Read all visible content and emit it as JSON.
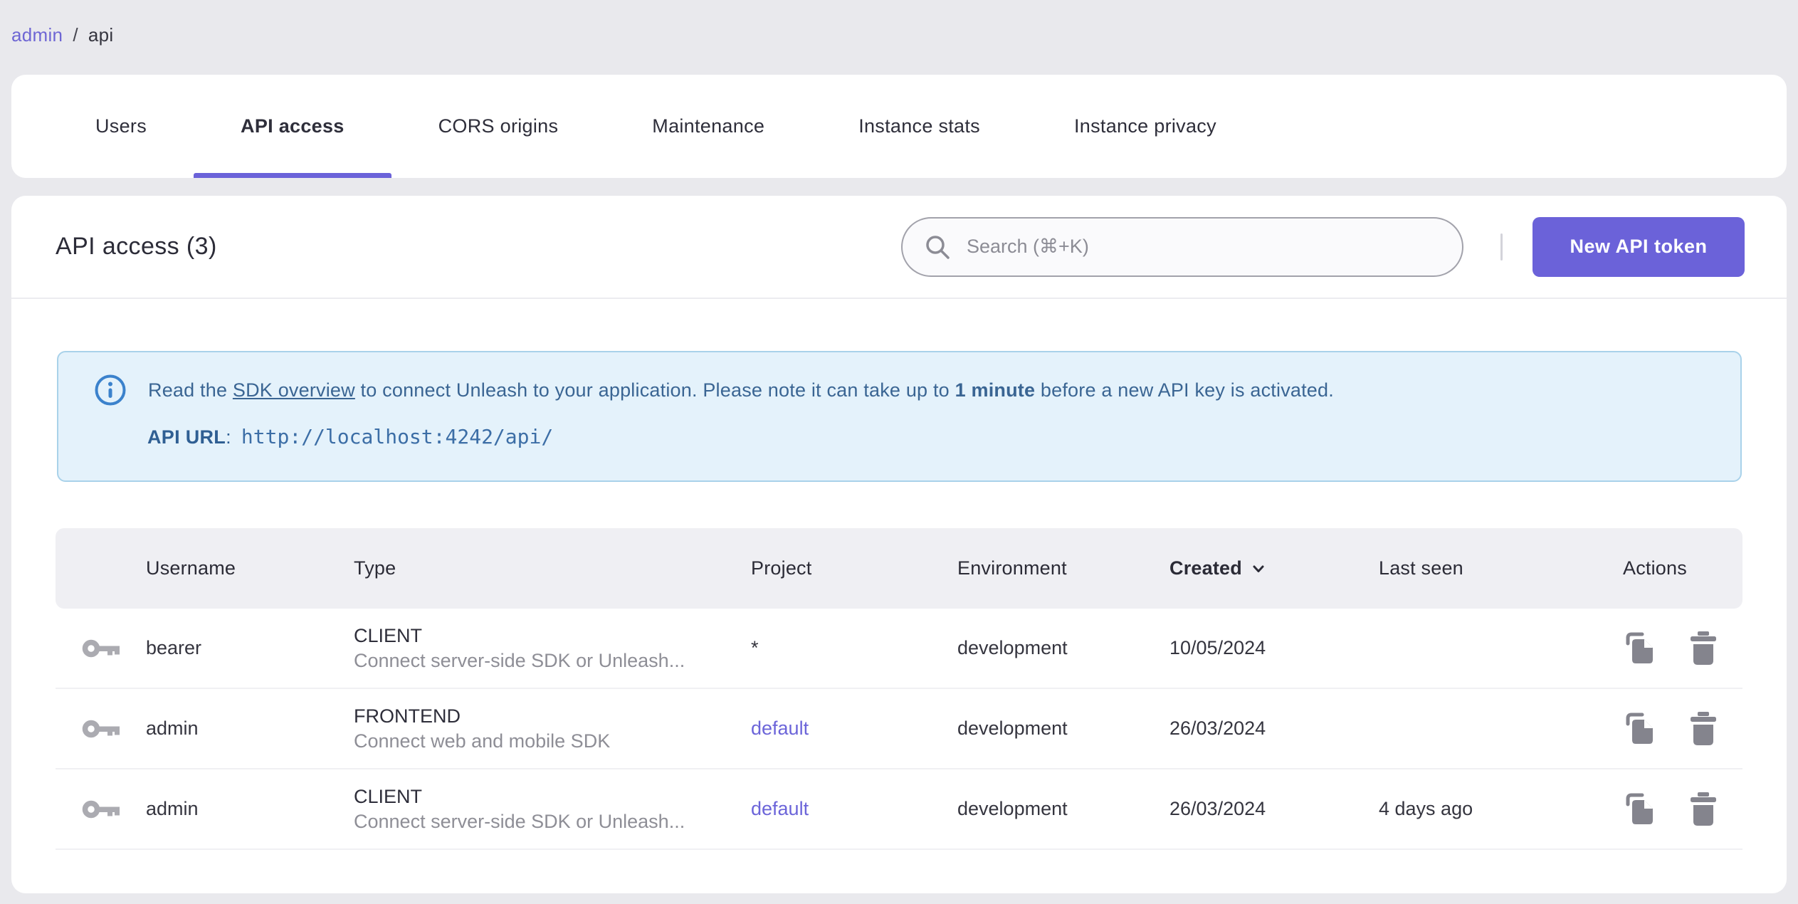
{
  "breadcrumb": {
    "items": [
      {
        "label": "admin"
      },
      {
        "label": "api"
      }
    ],
    "separator": "/"
  },
  "tabs": {
    "items": [
      {
        "label": "Users",
        "active": false
      },
      {
        "label": "API access",
        "active": true
      },
      {
        "label": "CORS origins",
        "active": false
      },
      {
        "label": "Maintenance",
        "active": false
      },
      {
        "label": "Instance stats",
        "active": false
      },
      {
        "label": "Instance privacy",
        "active": false
      }
    ]
  },
  "header": {
    "title": "API access (3)",
    "search_placeholder": "Search (⌘+K)",
    "new_token_button": "New API token"
  },
  "banner": {
    "text_before_link": "Read the ",
    "link_text": "SDK overview",
    "text_middle": " to connect Unleash to your application. Please note it can take up to ",
    "bold_text": "1 minute",
    "text_end": " before a new API key is activated.",
    "api_url_label": "API URL",
    "api_url_colon": ":",
    "api_url": "http://localhost:4242/api/"
  },
  "table": {
    "columns": [
      "Username",
      "Type",
      "Project",
      "Environment",
      "Created",
      "Last seen",
      "Actions"
    ],
    "sorted_column": "Created",
    "sort_direction": "desc",
    "rows": [
      {
        "username": "bearer",
        "type": "CLIENT",
        "type_description": "Connect server-side SDK or Unleash...",
        "project": "*",
        "project_is_link": false,
        "environment": "development",
        "created": "10/05/2024",
        "last_seen": ""
      },
      {
        "username": "admin",
        "type": "FRONTEND",
        "type_description": "Connect web and mobile SDK",
        "project": "default",
        "project_is_link": true,
        "environment": "development",
        "created": "26/03/2024",
        "last_seen": ""
      },
      {
        "username": "admin",
        "type": "CLIENT",
        "type_description": "Connect server-side SDK or Unleash...",
        "project": "default",
        "project_is_link": true,
        "environment": "development",
        "created": "26/03/2024",
        "last_seen": "4 days ago"
      }
    ]
  },
  "icons": {
    "search": "magnifier",
    "info": "circled-i",
    "key": "api-key",
    "copy": "duplicate-document",
    "delete": "trash-can",
    "sort": "chevron-down"
  },
  "colors": {
    "accent_purple": "#6b62d9",
    "link_purple": "#6c65d9",
    "banner_background": "#e4f2fb",
    "banner_border": "#a9d2ea",
    "banner_text": "#3a6593",
    "info_icon_blue": "#3b82cc",
    "page_background": "#e9e9ed",
    "table_header_background": "#efeff3",
    "icon_gray": "#84848d"
  }
}
